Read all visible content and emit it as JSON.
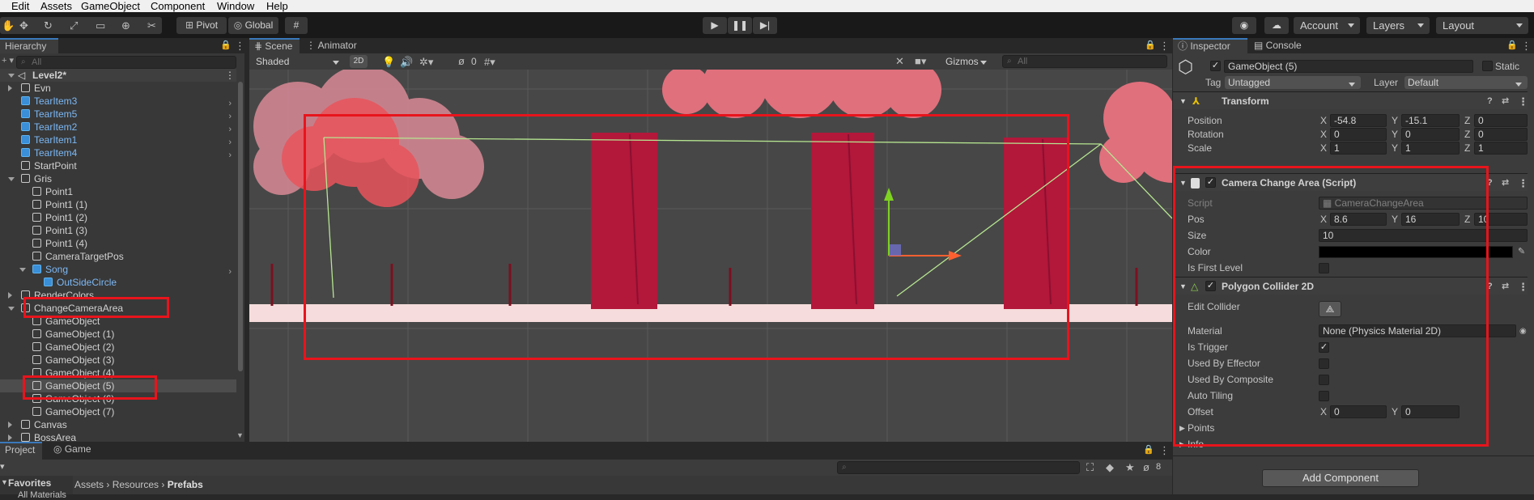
{
  "menu": [
    "Edit",
    "Assets",
    "GameObject",
    "Component",
    "Window",
    "Help"
  ],
  "toolbar": {
    "pivot": "Pivot",
    "global": "Global",
    "account": "Account",
    "layers": "Layers",
    "layout": "Layout"
  },
  "hierarchy": {
    "tab": "Hierarchy",
    "search_placeholder": "All",
    "scene": "Level2*",
    "rows": [
      {
        "label": "Evn",
        "indent": 1,
        "expand": "right",
        "blue": false,
        "chev": false
      },
      {
        "label": "TearItem3",
        "indent": 1,
        "expand": "",
        "blue": true,
        "chev": true
      },
      {
        "label": "TearItem5",
        "indent": 1,
        "expand": "",
        "blue": true,
        "chev": true
      },
      {
        "label": "TearItem2",
        "indent": 1,
        "expand": "",
        "blue": true,
        "chev": true
      },
      {
        "label": "TearItem1",
        "indent": 1,
        "expand": "",
        "blue": true,
        "chev": true
      },
      {
        "label": "TearItem4",
        "indent": 1,
        "expand": "",
        "blue": true,
        "chev": true
      },
      {
        "label": "StartPoint",
        "indent": 1,
        "expand": "",
        "blue": false,
        "chev": false
      },
      {
        "label": "Gris",
        "indent": 1,
        "expand": "down",
        "blue": false,
        "chev": false
      },
      {
        "label": "Point1",
        "indent": 2,
        "expand": "",
        "blue": false,
        "chev": false
      },
      {
        "label": "Point1 (1)",
        "indent": 2,
        "expand": "",
        "blue": false,
        "chev": false
      },
      {
        "label": "Point1 (2)",
        "indent": 2,
        "expand": "",
        "blue": false,
        "chev": false
      },
      {
        "label": "Point1 (3)",
        "indent": 2,
        "expand": "",
        "blue": false,
        "chev": false
      },
      {
        "label": "Point1 (4)",
        "indent": 2,
        "expand": "",
        "blue": false,
        "chev": false
      },
      {
        "label": "CameraTargetPos",
        "indent": 2,
        "expand": "",
        "blue": false,
        "chev": false
      },
      {
        "label": "Song",
        "indent": 2,
        "expand": "down",
        "blue": true,
        "chev": true
      },
      {
        "label": "OutSideCircle",
        "indent": 3,
        "expand": "",
        "blue": true,
        "chev": false
      },
      {
        "label": "RenderColors",
        "indent": 1,
        "expand": "right",
        "blue": false,
        "chev": false
      },
      {
        "label": "ChangeCameraArea",
        "indent": 1,
        "expand": "down",
        "blue": false,
        "chev": false
      },
      {
        "label": "GameObject",
        "indent": 2,
        "expand": "",
        "blue": false,
        "chev": false
      },
      {
        "label": "GameObject (1)",
        "indent": 2,
        "expand": "",
        "blue": false,
        "chev": false
      },
      {
        "label": "GameObject (2)",
        "indent": 2,
        "expand": "",
        "blue": false,
        "chev": false
      },
      {
        "label": "GameObject (3)",
        "indent": 2,
        "expand": "",
        "blue": false,
        "chev": false
      },
      {
        "label": "GameObject (4)",
        "indent": 2,
        "expand": "",
        "blue": false,
        "chev": false
      },
      {
        "label": "GameObject (5)",
        "indent": 2,
        "expand": "",
        "blue": false,
        "chev": false,
        "selected": true
      },
      {
        "label": "GameObject (6)",
        "indent": 2,
        "expand": "",
        "blue": false,
        "chev": false
      },
      {
        "label": "GameObject (7)",
        "indent": 2,
        "expand": "",
        "blue": false,
        "chev": false
      },
      {
        "label": "Canvas",
        "indent": 1,
        "expand": "right",
        "blue": false,
        "chev": false
      },
      {
        "label": "BossArea",
        "indent": 1,
        "expand": "right",
        "blue": false,
        "chev": false
      }
    ]
  },
  "scene": {
    "tab_scene": "Scene",
    "tab_animator": "Animator",
    "shading": "Shaded",
    "mode_2d": "2D",
    "hidden_count": "0",
    "gizmos": "Gizmos",
    "search_placeholder": "All"
  },
  "project": {
    "tab_project": "Project",
    "tab_game": "Game",
    "favorites": "Favorites",
    "favorites_item": "All Materials",
    "breadcrumb": [
      "Assets",
      "Resources",
      "Prefabs"
    ],
    "hidden_count": "8"
  },
  "inspector": {
    "tab_inspector": "Inspector",
    "tab_console": "Console",
    "name": "GameObject (5)",
    "static": "Static",
    "tag_label": "Tag",
    "tag": "Untagged",
    "layer_label": "Layer",
    "layer": "Default",
    "transform": {
      "title": "Transform",
      "position_label": "Position",
      "position": [
        "-54.8",
        "-15.1",
        "0"
      ],
      "rotation_label": "Rotation",
      "rotation": [
        "0",
        "0",
        "0"
      ],
      "scale_label": "Scale",
      "scale": [
        "1",
        "1",
        "1"
      ]
    },
    "camera_area": {
      "title": "Camera Change Area (Script)",
      "script_label": "Script",
      "script": "CameraChangeArea",
      "pos_label": "Pos",
      "pos": [
        "8.6",
        "16",
        "10"
      ],
      "size_label": "Size",
      "size": "10",
      "color_label": "Color",
      "first_level_label": "Is First Level"
    },
    "polygon": {
      "title": "Polygon Collider 2D",
      "edit_label": "Edit Collider",
      "material_label": "Material",
      "material": "None (Physics Material 2D)",
      "trigger_label": "Is Trigger",
      "effector_label": "Used By Effector",
      "composite_label": "Used By Composite",
      "tiling_label": "Auto Tiling",
      "offset_label": "Offset",
      "offset": [
        "0",
        "0"
      ],
      "points_label": "Points",
      "info_label": "Info"
    },
    "add_component": "Add Component"
  },
  "axis_labels": {
    "x": "X",
    "y": "Y",
    "z": "Z"
  }
}
